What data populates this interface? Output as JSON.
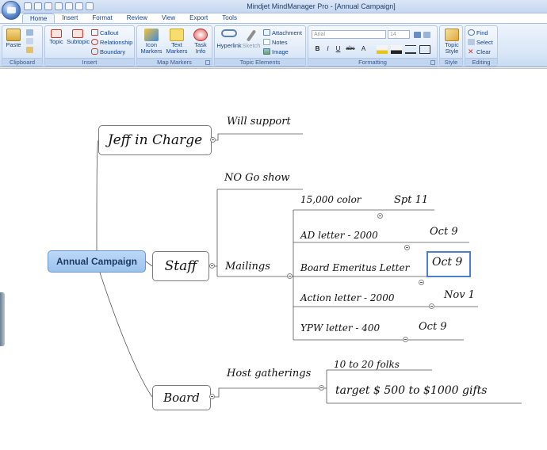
{
  "window": {
    "title": "Mindjet MindManager Pro - [Annual Campaign]"
  },
  "tabs": [
    "Home",
    "Insert",
    "Format",
    "Review",
    "View",
    "Export",
    "Tools"
  ],
  "ribbon": {
    "clipboard": {
      "label": "Clipboard",
      "paste": "Paste"
    },
    "insert": {
      "label": "Insert",
      "topic": "Topic",
      "subtopic": "Subtopic",
      "callout": "Callout",
      "relationship": "Relationship",
      "boundary": "Boundary"
    },
    "map_markers": {
      "label": "Map Markers",
      "icon_markers_1": "Icon",
      "icon_markers_2": "Markers",
      "text_markers_1": "Text",
      "text_markers_2": "Markers",
      "task_info_1": "Task",
      "task_info_2": "Info"
    },
    "topic_elements": {
      "label": "Topic Elements",
      "hyperlink": "Hyperlink",
      "sketch": "Sketch",
      "attachment": "Attachment",
      "notes": "Notes",
      "image": "Image"
    },
    "formatting": {
      "label": "Formatting",
      "font": "Arial",
      "size": "14",
      "bold": "B",
      "italic": "I",
      "underline": "U",
      "strike": "abc",
      "font_color": "A"
    },
    "style": {
      "label": "Style",
      "topic_style_1": "Topic",
      "topic_style_2": "Style"
    },
    "editing": {
      "label": "Editing",
      "find": "Find",
      "select": "Select",
      "clear": "Clear"
    }
  },
  "map": {
    "central": "Annual Campaign",
    "branches": [
      {
        "id": "jeff",
        "label": "Jeff in Charge",
        "subtopics": [
          "Will support"
        ]
      },
      {
        "id": "staff",
        "label": "Staff",
        "subtopics": [
          "NO Go show",
          "Mailings"
        ],
        "mailings": [
          {
            "text": "15,000 color",
            "date": "Spt 11"
          },
          {
            "text": "AD letter - 2000",
            "date": "Oct 9"
          },
          {
            "text": "Board Emeritus Letter",
            "date": "Oct 9"
          },
          {
            "text": "Action letter - 2000",
            "date": "Nov 1"
          },
          {
            "text": "YPW letter - 400",
            "date": "Oct 9"
          }
        ]
      },
      {
        "id": "board",
        "label": "Board",
        "subtopics": [
          "Host gatherings"
        ],
        "gatherings_note": "10 to 20 folks",
        "gatherings_target": "target $ 500 to $1000 gifts"
      }
    ]
  }
}
